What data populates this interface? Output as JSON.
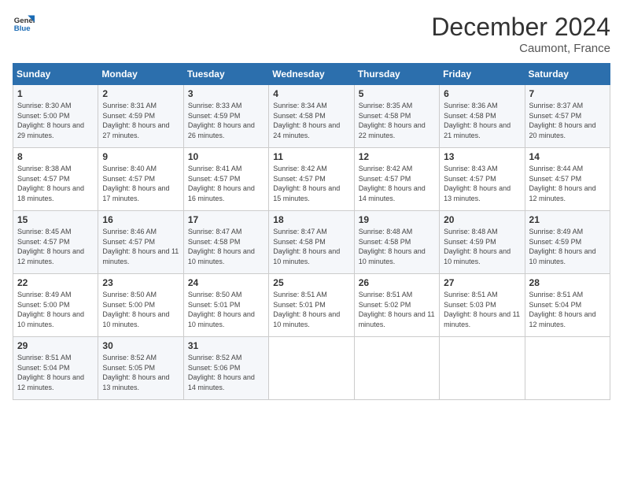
{
  "header": {
    "logo_line1": "General",
    "logo_line2": "Blue",
    "month": "December 2024",
    "location": "Caumont, France"
  },
  "weekdays": [
    "Sunday",
    "Monday",
    "Tuesday",
    "Wednesday",
    "Thursday",
    "Friday",
    "Saturday"
  ],
  "weeks": [
    [
      {
        "day": 1,
        "rise": "8:30 AM",
        "set": "5:00 PM",
        "daylight": "8 hours and 29 minutes."
      },
      {
        "day": 2,
        "rise": "8:31 AM",
        "set": "4:59 PM",
        "daylight": "8 hours and 27 minutes."
      },
      {
        "day": 3,
        "rise": "8:33 AM",
        "set": "4:59 PM",
        "daylight": "8 hours and 26 minutes."
      },
      {
        "day": 4,
        "rise": "8:34 AM",
        "set": "4:58 PM",
        "daylight": "8 hours and 24 minutes."
      },
      {
        "day": 5,
        "rise": "8:35 AM",
        "set": "4:58 PM",
        "daylight": "8 hours and 22 minutes."
      },
      {
        "day": 6,
        "rise": "8:36 AM",
        "set": "4:58 PM",
        "daylight": "8 hours and 21 minutes."
      },
      {
        "day": 7,
        "rise": "8:37 AM",
        "set": "4:57 PM",
        "daylight": "8 hours and 20 minutes."
      }
    ],
    [
      {
        "day": 8,
        "rise": "8:38 AM",
        "set": "4:57 PM",
        "daylight": "8 hours and 18 minutes."
      },
      {
        "day": 9,
        "rise": "8:40 AM",
        "set": "4:57 PM",
        "daylight": "8 hours and 17 minutes."
      },
      {
        "day": 10,
        "rise": "8:41 AM",
        "set": "4:57 PM",
        "daylight": "8 hours and 16 minutes."
      },
      {
        "day": 11,
        "rise": "8:42 AM",
        "set": "4:57 PM",
        "daylight": "8 hours and 15 minutes."
      },
      {
        "day": 12,
        "rise": "8:42 AM",
        "set": "4:57 PM",
        "daylight": "8 hours and 14 minutes."
      },
      {
        "day": 13,
        "rise": "8:43 AM",
        "set": "4:57 PM",
        "daylight": "8 hours and 13 minutes."
      },
      {
        "day": 14,
        "rise": "8:44 AM",
        "set": "4:57 PM",
        "daylight": "8 hours and 12 minutes."
      }
    ],
    [
      {
        "day": 15,
        "rise": "8:45 AM",
        "set": "4:57 PM",
        "daylight": "8 hours and 12 minutes."
      },
      {
        "day": 16,
        "rise": "8:46 AM",
        "set": "4:57 PM",
        "daylight": "8 hours and 11 minutes."
      },
      {
        "day": 17,
        "rise": "8:47 AM",
        "set": "4:58 PM",
        "daylight": "8 hours and 10 minutes."
      },
      {
        "day": 18,
        "rise": "8:47 AM",
        "set": "4:58 PM",
        "daylight": "8 hours and 10 minutes."
      },
      {
        "day": 19,
        "rise": "8:48 AM",
        "set": "4:58 PM",
        "daylight": "8 hours and 10 minutes."
      },
      {
        "day": 20,
        "rise": "8:48 AM",
        "set": "4:59 PM",
        "daylight": "8 hours and 10 minutes."
      },
      {
        "day": 21,
        "rise": "8:49 AM",
        "set": "4:59 PM",
        "daylight": "8 hours and 10 minutes."
      }
    ],
    [
      {
        "day": 22,
        "rise": "8:49 AM",
        "set": "5:00 PM",
        "daylight": "8 hours and 10 minutes."
      },
      {
        "day": 23,
        "rise": "8:50 AM",
        "set": "5:00 PM",
        "daylight": "8 hours and 10 minutes."
      },
      {
        "day": 24,
        "rise": "8:50 AM",
        "set": "5:01 PM",
        "daylight": "8 hours and 10 minutes."
      },
      {
        "day": 25,
        "rise": "8:51 AM",
        "set": "5:01 PM",
        "daylight": "8 hours and 10 minutes."
      },
      {
        "day": 26,
        "rise": "8:51 AM",
        "set": "5:02 PM",
        "daylight": "8 hours and 11 minutes."
      },
      {
        "day": 27,
        "rise": "8:51 AM",
        "set": "5:03 PM",
        "daylight": "8 hours and 11 minutes."
      },
      {
        "day": 28,
        "rise": "8:51 AM",
        "set": "5:04 PM",
        "daylight": "8 hours and 12 minutes."
      }
    ],
    [
      {
        "day": 29,
        "rise": "8:51 AM",
        "set": "5:04 PM",
        "daylight": "8 hours and 12 minutes."
      },
      {
        "day": 30,
        "rise": "8:52 AM",
        "set": "5:05 PM",
        "daylight": "8 hours and 13 minutes."
      },
      {
        "day": 31,
        "rise": "8:52 AM",
        "set": "5:06 PM",
        "daylight": "8 hours and 14 minutes."
      },
      null,
      null,
      null,
      null
    ]
  ]
}
